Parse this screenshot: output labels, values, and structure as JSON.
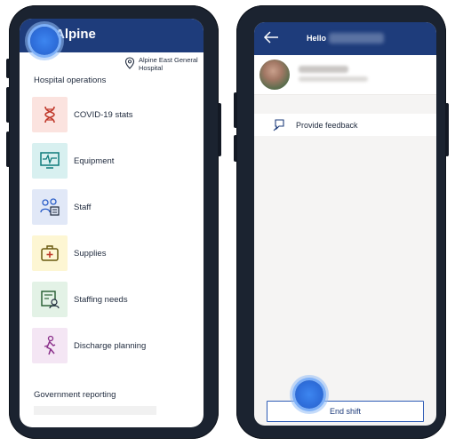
{
  "left_app": {
    "title": "Alpine",
    "location": {
      "line1": "Alpine East General",
      "line2": "Hospital",
      "icon": "location-pin-icon"
    },
    "section_title": "Hospital operations",
    "items": [
      {
        "label": "COVID-19 stats",
        "icon": "dna-icon",
        "tile_color": "#fbe3df",
        "icon_color": "#c0392b"
      },
      {
        "label": "Equipment",
        "icon": "monitor-icon",
        "tile_color": "#d8f0f0",
        "icon_color": "#0e7a7a"
      },
      {
        "label": "Staff",
        "icon": "people-icon",
        "tile_color": "#e1e8f7",
        "icon_color": "#2b5ec8"
      },
      {
        "label": "Supplies",
        "icon": "first-aid-kit-icon",
        "tile_color": "#fdf6d3",
        "icon_color": "#6a5a10"
      },
      {
        "label": "Staffing needs",
        "icon": "staffing-board-icon",
        "tile_color": "#e3f2e6",
        "icon_color": "#225a2e"
      },
      {
        "label": "Discharge planning",
        "icon": "walking-person-icon",
        "tile_color": "#f4e6f4",
        "icon_color": "#8a2f8a"
      }
    ],
    "government_title": "Government reporting"
  },
  "right_app": {
    "greeting": "Hello",
    "feedback_label": "Provide  feedback",
    "end_shift_label": "End shift",
    "icons": {
      "back": "back-arrow-icon",
      "feedback": "feedback-icon"
    }
  },
  "colors": {
    "header": "#1e3c7b",
    "accent": "#2d5bb5",
    "touch": "#2f6fdc"
  }
}
